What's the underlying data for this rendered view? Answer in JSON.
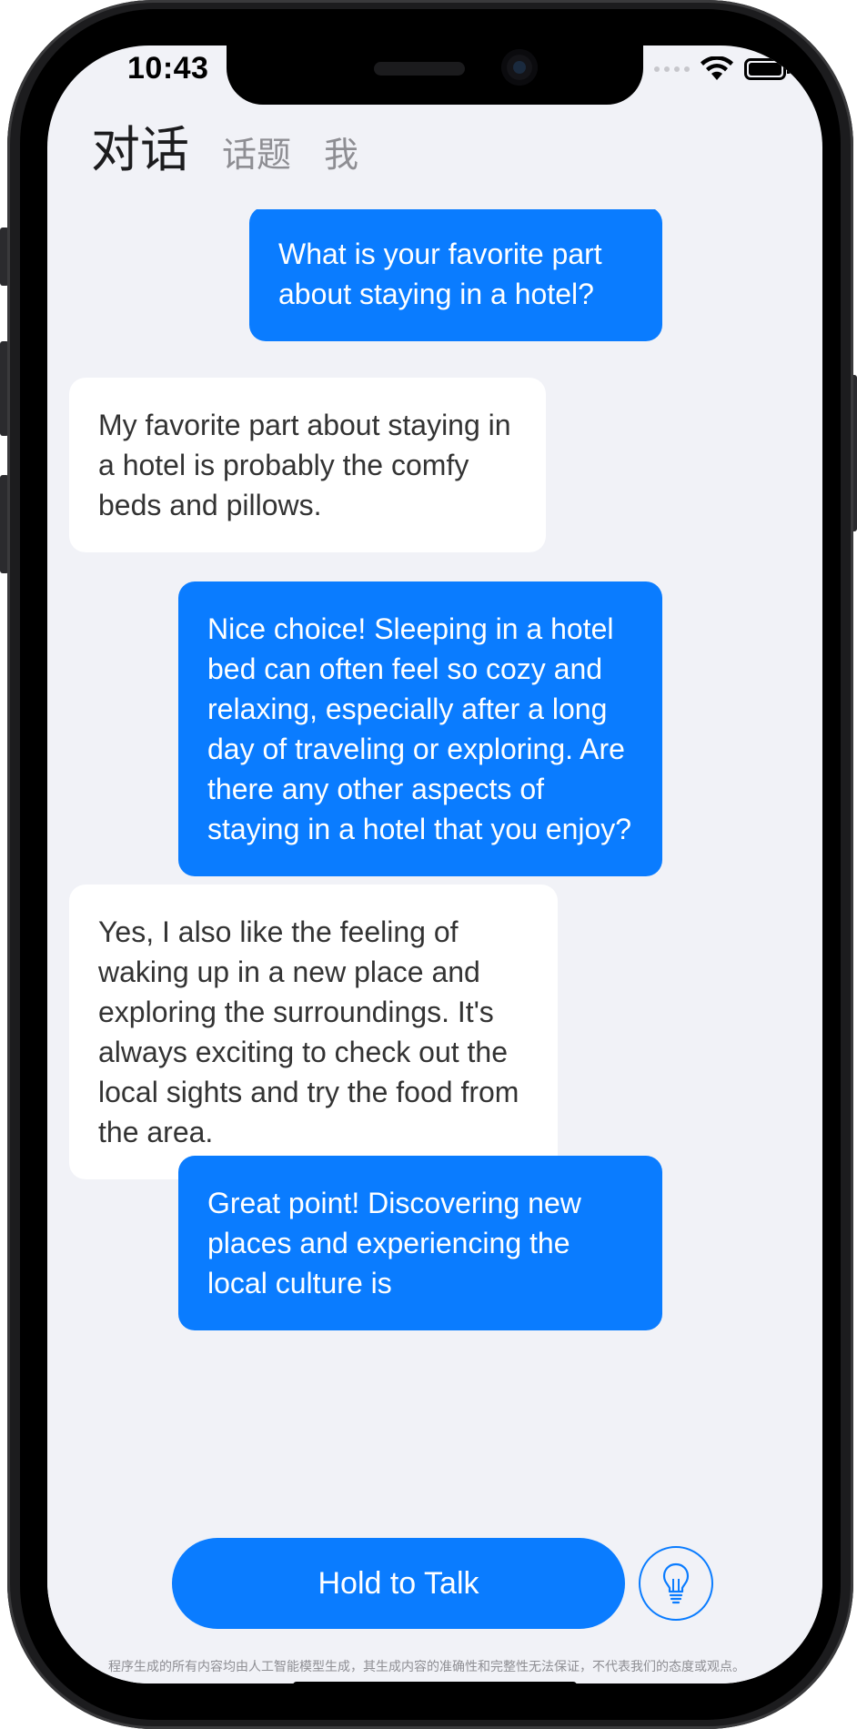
{
  "status_bar": {
    "time": "10:43"
  },
  "tabs": [
    {
      "label": "对话",
      "active": true
    },
    {
      "label": "话题",
      "active": false
    },
    {
      "label": "我",
      "active": false
    }
  ],
  "messages": [
    {
      "role": "user",
      "text": "What is your favorite part about staying in a hotel?"
    },
    {
      "role": "bot",
      "text": "My favorite part about staying in a hotel is probably the comfy beds and pillows."
    },
    {
      "role": "user",
      "text": "Nice choice! Sleeping in a hotel bed can often feel so cozy and relaxing, especially after a long day of traveling or exploring. Are there any other aspects of staying in a hotel that you enjoy?"
    },
    {
      "role": "bot",
      "text": "Yes, I also like the feeling of waking up in a new place and exploring the surroundings. It's always exciting to check out the local sights and try the food from the area."
    },
    {
      "role": "user",
      "text": "Great point! Discovering new places and experiencing the local culture is"
    }
  ],
  "controls": {
    "talk_label": "Hold to Talk",
    "hint_icon": "lightbulb-icon"
  },
  "disclaimer": "程序生成的所有内容均由人工智能模型生成，其生成内容的准确性和完整性无法保证，不代表我们的态度或观点。",
  "colors": {
    "accent": "#0a7cff",
    "background": "#f1f2f7",
    "bot_bubble": "#ffffff"
  }
}
